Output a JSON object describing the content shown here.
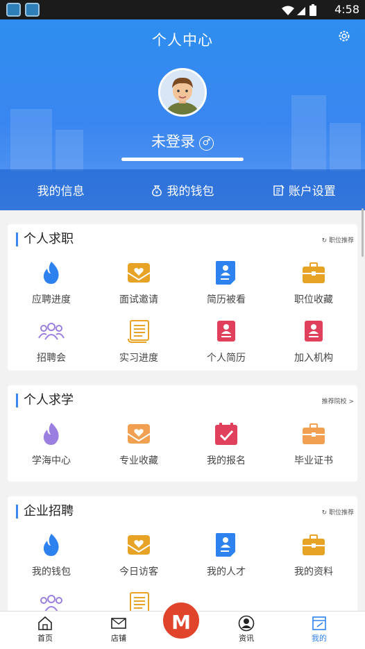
{
  "status": {
    "time": "4:58"
  },
  "header": {
    "title": "个人中心",
    "username": "未登录",
    "gender_symbol": "♂"
  },
  "tabs": [
    {
      "label": "我的信息"
    },
    {
      "label": "我的钱包",
      "icon": "money-bag-icon"
    },
    {
      "label": "账户设置",
      "icon": "edit-icon"
    }
  ],
  "job": {
    "title": "个人求职",
    "link": "职位推荐",
    "items": [
      {
        "label": "应聘进度",
        "icon": "flame-icon",
        "color": "#2e82f0"
      },
      {
        "label": "面试邀请",
        "icon": "envelope-heart-icon",
        "color": "#e6a325"
      },
      {
        "label": "简历被看",
        "icon": "resume-person-icon",
        "color": "#2e82f0"
      },
      {
        "label": "职位收藏",
        "icon": "briefcase-icon",
        "color": "#e6a325"
      },
      {
        "label": "招聘会",
        "icon": "people-group-icon",
        "color": "#9b7fe0"
      },
      {
        "label": "实习进度",
        "icon": "scroll-icon",
        "color": "#e6a325"
      },
      {
        "label": "个人简历",
        "icon": "id-card-icon",
        "color": "#e0405b"
      },
      {
        "label": "加入机构",
        "icon": "id-card-icon",
        "color": "#e0405b"
      }
    ]
  },
  "study": {
    "title": "个人求学",
    "link": "推荐院校 >",
    "items": [
      {
        "label": "学海中心",
        "icon": "flame-icon",
        "color": "#9b7fe0"
      },
      {
        "label": "专业收藏",
        "icon": "envelope-heart-icon",
        "color": "#f0a050"
      },
      {
        "label": "我的报名",
        "icon": "calendar-check-icon",
        "color": "#e0405b"
      },
      {
        "label": "毕业证书",
        "icon": "briefcase-icon",
        "color": "#f0a050"
      }
    ]
  },
  "corp": {
    "title": "企业招聘",
    "link": "职位推荐",
    "items": [
      {
        "label": "我的钱包",
        "icon": "flame-icon",
        "color": "#2e82f0"
      },
      {
        "label": "今日访客",
        "icon": "envelope-heart-icon",
        "color": "#e6a325"
      },
      {
        "label": "我的人才",
        "icon": "resume-person-icon",
        "color": "#2e82f0"
      },
      {
        "label": "我的资料",
        "icon": "briefcase-icon",
        "color": "#e6a325"
      },
      {
        "label": "",
        "icon": "people-group-icon",
        "color": "#9b7fe0"
      },
      {
        "label": "",
        "icon": "scroll-icon",
        "color": "#e6a325"
      }
    ]
  },
  "nav": {
    "items": [
      {
        "label": "首页",
        "icon": "home-icon"
      },
      {
        "label": "店铺",
        "icon": "mail-icon"
      },
      {
        "label": "资讯",
        "icon": "user-circle-icon"
      },
      {
        "label": "我的",
        "icon": "profile-window-icon",
        "active_color": "#2e82f0"
      }
    ],
    "center": "M"
  }
}
